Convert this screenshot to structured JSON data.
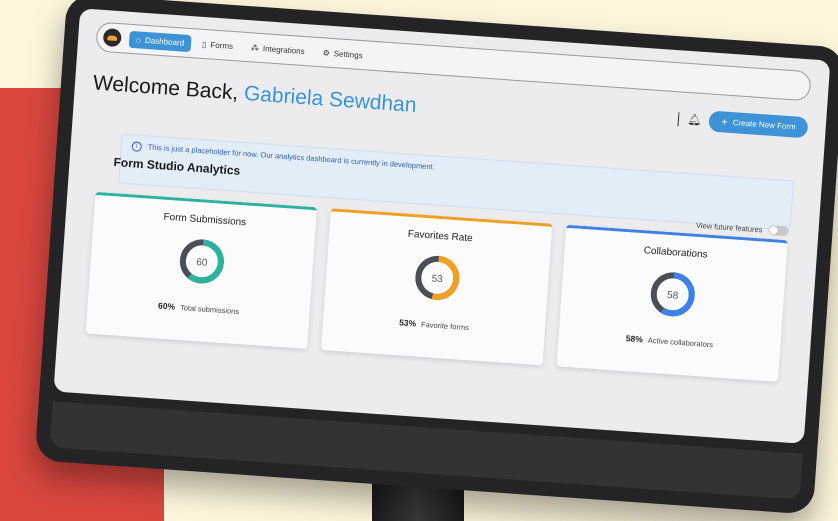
{
  "nav": {
    "items": [
      {
        "label": "Dashboard",
        "icon": "home-icon",
        "active": true
      },
      {
        "label": "Forms",
        "icon": "document-icon",
        "active": false
      },
      {
        "label": "Integrations",
        "icon": "integrations-icon",
        "active": false
      },
      {
        "label": "Settings",
        "icon": "settings-icon",
        "active": false
      }
    ]
  },
  "header": {
    "welcome": "Welcome Back,",
    "user_name": "Gabriela Sewdhan",
    "create_button": "Create New Form"
  },
  "banner": {
    "text": "This is just a placeholder for now. Our analytics dashboard is currently in development."
  },
  "analytics": {
    "title": "Form Studio Analytics",
    "toggle_label": "View future features",
    "cards": [
      {
        "title": "Form Submissions",
        "value": 60,
        "percent_label": "60%",
        "caption": "Total submissions",
        "color": "#2bb3a0"
      },
      {
        "title": "Favorites Rate",
        "value": 53,
        "percent_label": "53%",
        "caption": "Favorite forms",
        "color": "#f0a020"
      },
      {
        "title": "Collaborations",
        "value": 58,
        "percent_label": "58%",
        "caption": "Active collaborators",
        "color": "#3d82e8"
      }
    ]
  },
  "colors": {
    "accent": "#3d93d6",
    "background": "#fdf6dc",
    "red_block": "#d9473f"
  }
}
